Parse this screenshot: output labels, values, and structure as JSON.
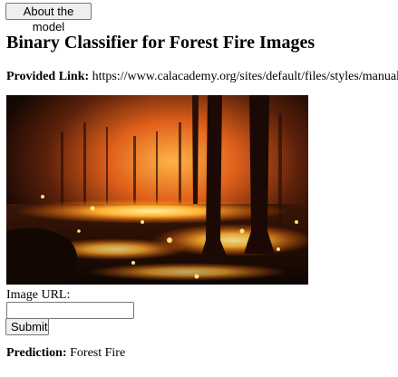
{
  "header": {
    "about_button_label": "About the model"
  },
  "main": {
    "title": "Binary Classifier for Forest Fire Images",
    "link_label": "Provided Link:",
    "link_url": "https://www.calacademy.org/sites/default/files/styles/manual_crop",
    "form": {
      "image_url_label": "Image URL:",
      "image_url_value": "",
      "submit_label": "Submit"
    },
    "prediction": {
      "label": "Prediction:",
      "value": "Forest Fire"
    }
  },
  "colors": {
    "fire_bright": "#ffd24a",
    "fire_orange": "#ff7a1a",
    "smoke_dark": "#1b0d05",
    "button_bg": "#efefef"
  }
}
